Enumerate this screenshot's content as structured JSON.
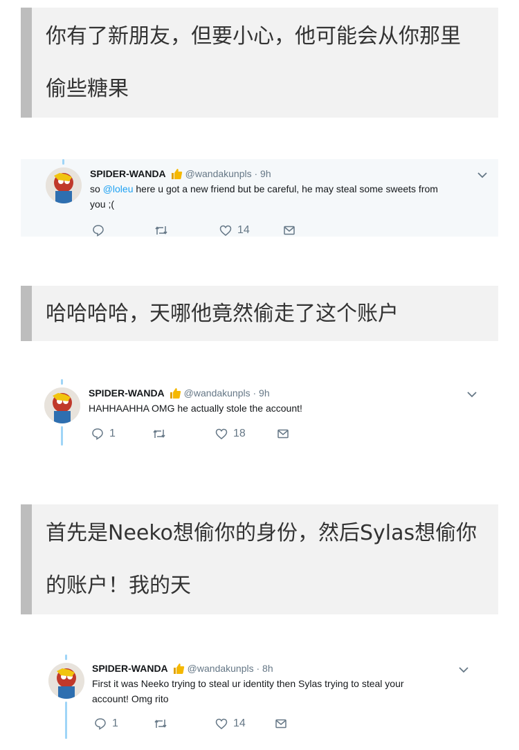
{
  "captions": [
    {
      "line1": "你有了新朋友，但要小心，他可能会从你那里",
      "line2": "偷些糖果"
    },
    {
      "line1": "哈哈哈哈，天哪他竟然偷走了这个账户"
    },
    {
      "line1": "首先是Neeko想偷你的身份，然后Sylas想偷你",
      "line2": "的账户！我的天"
    }
  ],
  "tweets": [
    {
      "author": "SPIDER-WANDA",
      "emoji": "thumbs-up",
      "handle_time": "@wandakunpls · 9h",
      "text_pre": "so ",
      "mention": "@loleu",
      "text_line1_rest": " here u got a new friend but be careful, he may steal some sweets from",
      "text_line2": "you ;(",
      "replies": "",
      "retweets": "",
      "likes": "14"
    },
    {
      "author": "SPIDER-WANDA",
      "emoji": "thumbs-up",
      "handle_time": "@wandakunpls · 9h",
      "text_line1": "HAHHAAHHA OMG he actually stole the account!",
      "replies": "1",
      "retweets": "",
      "likes": "18"
    },
    {
      "author": "SPIDER-WANDA",
      "emoji": "thumbs-up",
      "handle_time": "@wandakunpls · 8h",
      "text_line1": "First it was Neeko trying to steal ur identity then Sylas trying to steal your",
      "text_line2": "account! Omg rito",
      "replies": "1",
      "retweets": "",
      "likes": "14"
    }
  ],
  "colors": {
    "mention": "#1da1f2",
    "thread_line": "#9fd5f7",
    "caption_bar": "#bdbdbd"
  }
}
